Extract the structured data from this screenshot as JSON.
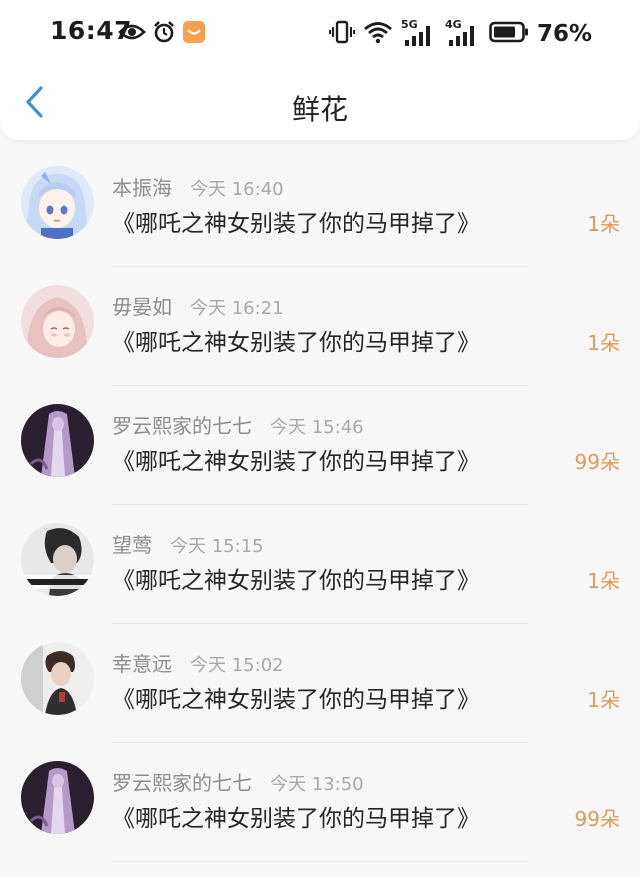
{
  "status_bar": {
    "time": "16:47",
    "network_5g": "5G",
    "network_4g": "4G",
    "battery": "76%"
  },
  "header": {
    "title": "鲜花",
    "back_icon": "chevron-left-icon"
  },
  "records": [
    {
      "user": "本振海",
      "time": "今天 16:40",
      "book": "《哪吒之神女别装了你的马甲掉了》",
      "count": "1朵"
    },
    {
      "user": "毋晏如",
      "time": "今天 16:21",
      "book": "《哪吒之神女别装了你的马甲掉了》",
      "count": "1朵"
    },
    {
      "user": "罗云熙家的七七",
      "time": "今天 15:46",
      "book": "《哪吒之神女别装了你的马甲掉了》",
      "count": "99朵"
    },
    {
      "user": "望莺",
      "time": "今天 15:15",
      "book": "《哪吒之神女别装了你的马甲掉了》",
      "count": "1朵"
    },
    {
      "user": "幸意远",
      "time": "今天 15:02",
      "book": "《哪吒之神女别装了你的马甲掉了》",
      "count": "1朵"
    },
    {
      "user": "罗云熙家的七七",
      "time": "今天 13:50",
      "book": "《哪吒之神女别装了你的马甲掉了》",
      "count": "99朵"
    }
  ],
  "colors": {
    "accent_blue": "#3d8fe0",
    "count_orange": "#e39a57",
    "alarm_badge": "#f5a04a"
  }
}
